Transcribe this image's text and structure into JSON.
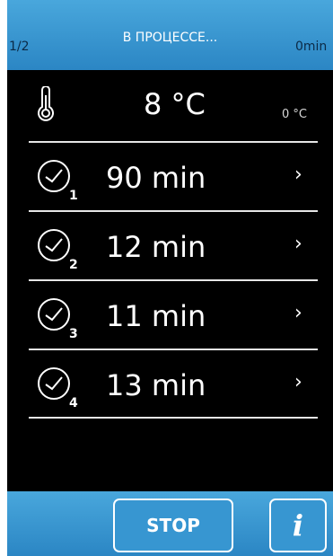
{
  "header": {
    "page_indicator": "1/2",
    "status": "В ПРОЦЕССЕ...",
    "elapsed": "0min"
  },
  "temperature": {
    "icon": "thermometer-icon",
    "value": "8 °C",
    "setpoint": "0 °C"
  },
  "timers": [
    {
      "icon": "clock-icon",
      "index": "1",
      "value": "90 min",
      "chevron": "›"
    },
    {
      "icon": "clock-icon",
      "index": "2",
      "value": "12 min",
      "chevron": "›"
    },
    {
      "icon": "clock-icon",
      "index": "3",
      "value": "11 min",
      "chevron": "›"
    },
    {
      "icon": "clock-icon",
      "index": "4",
      "value": "13 min",
      "chevron": "›"
    }
  ],
  "footer": {
    "stop_label": "STOP",
    "info_label": "i"
  },
  "colors": {
    "bar_blue": "#2b86c4",
    "background": "#000000",
    "text": "#ffffff"
  }
}
